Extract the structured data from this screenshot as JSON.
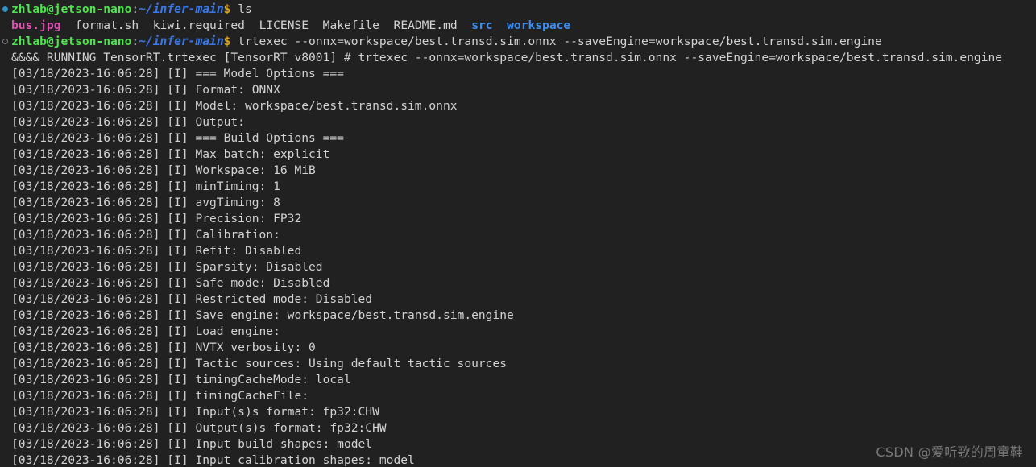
{
  "terminal": {
    "background": "#212121",
    "foreground": "#d2d2d2",
    "colors": {
      "user_host": "#4ee44e",
      "path": "#3b78e7",
      "dollar": "#d9a520",
      "directory": "#3b8ef0",
      "image_file": "#e050b0",
      "bullet_success": "#2a94c6",
      "bullet_pending": "#7a7a7a"
    },
    "prompt": {
      "user_host": "zhlab@jetson-nano",
      "separator": ":",
      "path": "~/infer-main",
      "sigil": "$"
    },
    "lines": [
      {
        "type": "prompt",
        "bullet": "filled",
        "command": "ls"
      },
      {
        "type": "file-listing",
        "files": [
          {
            "name": "bus.jpg",
            "kind": "image"
          },
          {
            "name": "format.sh",
            "kind": "file"
          },
          {
            "name": "kiwi.required",
            "kind": "file"
          },
          {
            "name": "LICENSE",
            "kind": "file"
          },
          {
            "name": "Makefile",
            "kind": "file"
          },
          {
            "name": "README.md",
            "kind": "file"
          },
          {
            "name": "src",
            "kind": "directory"
          },
          {
            "name": "workspace",
            "kind": "directory"
          }
        ]
      },
      {
        "type": "prompt",
        "bullet": "hollow",
        "command": "trtexec --onnx=workspace/best.transd.sim.onnx --saveEngine=workspace/best.transd.sim.engine"
      },
      {
        "type": "output",
        "text": "&&&& RUNNING TensorRT.trtexec [TensorRT v8001] # trtexec --onnx=workspace/best.transd.sim.onnx --saveEngine=workspace/best.transd.sim.engine"
      },
      {
        "type": "output",
        "text": "[03/18/2023-16:06:28] [I] === Model Options ==="
      },
      {
        "type": "output",
        "text": "[03/18/2023-16:06:28] [I] Format: ONNX"
      },
      {
        "type": "output",
        "text": "[03/18/2023-16:06:28] [I] Model: workspace/best.transd.sim.onnx"
      },
      {
        "type": "output",
        "text": "[03/18/2023-16:06:28] [I] Output:"
      },
      {
        "type": "output",
        "text": "[03/18/2023-16:06:28] [I] === Build Options ==="
      },
      {
        "type": "output",
        "text": "[03/18/2023-16:06:28] [I] Max batch: explicit"
      },
      {
        "type": "output",
        "text": "[03/18/2023-16:06:28] [I] Workspace: 16 MiB"
      },
      {
        "type": "output",
        "text": "[03/18/2023-16:06:28] [I] minTiming: 1"
      },
      {
        "type": "output",
        "text": "[03/18/2023-16:06:28] [I] avgTiming: 8"
      },
      {
        "type": "output",
        "text": "[03/18/2023-16:06:28] [I] Precision: FP32"
      },
      {
        "type": "output",
        "text": "[03/18/2023-16:06:28] [I] Calibration:"
      },
      {
        "type": "output",
        "text": "[03/18/2023-16:06:28] [I] Refit: Disabled"
      },
      {
        "type": "output",
        "text": "[03/18/2023-16:06:28] [I] Sparsity: Disabled"
      },
      {
        "type": "output",
        "text": "[03/18/2023-16:06:28] [I] Safe mode: Disabled"
      },
      {
        "type": "output",
        "text": "[03/18/2023-16:06:28] [I] Restricted mode: Disabled"
      },
      {
        "type": "output",
        "text": "[03/18/2023-16:06:28] [I] Save engine: workspace/best.transd.sim.engine"
      },
      {
        "type": "output",
        "text": "[03/18/2023-16:06:28] [I] Load engine:"
      },
      {
        "type": "output",
        "text": "[03/18/2023-16:06:28] [I] NVTX verbosity: 0"
      },
      {
        "type": "output",
        "text": "[03/18/2023-16:06:28] [I] Tactic sources: Using default tactic sources"
      },
      {
        "type": "output",
        "text": "[03/18/2023-16:06:28] [I] timingCacheMode: local"
      },
      {
        "type": "output",
        "text": "[03/18/2023-16:06:28] [I] timingCacheFile:"
      },
      {
        "type": "output",
        "text": "[03/18/2023-16:06:28] [I] Input(s)s format: fp32:CHW"
      },
      {
        "type": "output",
        "text": "[03/18/2023-16:06:28] [I] Output(s)s format: fp32:CHW"
      },
      {
        "type": "output",
        "text": "[03/18/2023-16:06:28] [I] Input build shapes: model"
      },
      {
        "type": "output",
        "text": "[03/18/2023-16:06:28] [I] Input calibration shapes: model"
      }
    ]
  },
  "watermark": {
    "text": "CSDN @爱听歌的周童鞋"
  }
}
